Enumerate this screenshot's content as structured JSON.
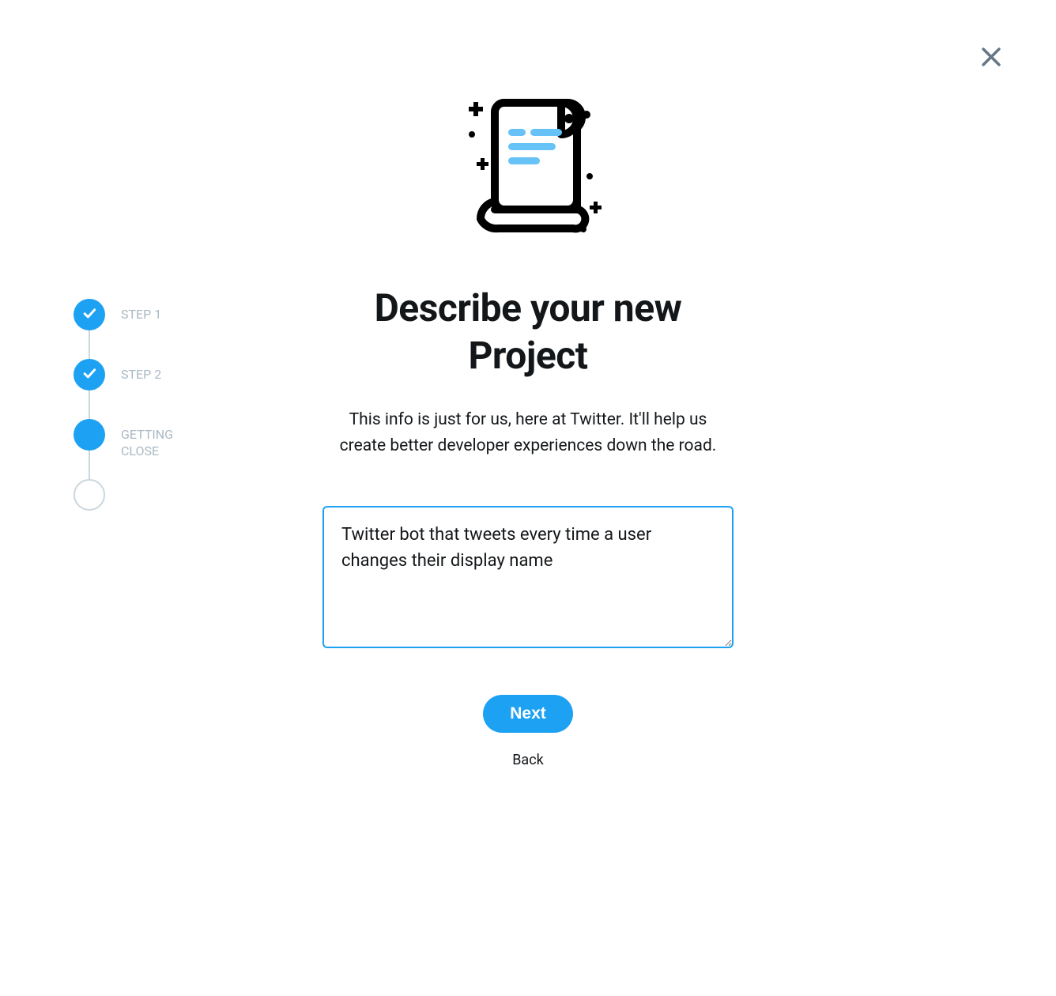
{
  "stepper": {
    "steps": [
      {
        "label": "STEP 1",
        "state": "done"
      },
      {
        "label": "STEP 2",
        "state": "done"
      },
      {
        "label": "GETTING CLOSE",
        "state": "current"
      },
      {
        "label": "",
        "state": "pending"
      }
    ]
  },
  "main": {
    "heading": "Describe your new Project",
    "subtext": "This info is just for us, here at Twitter. It'll help us create better developer experiences down the road.",
    "textarea_value": "Twitter bot that tweets every time a user changes their display name"
  },
  "actions": {
    "next_label": "Next",
    "back_label": "Back"
  }
}
